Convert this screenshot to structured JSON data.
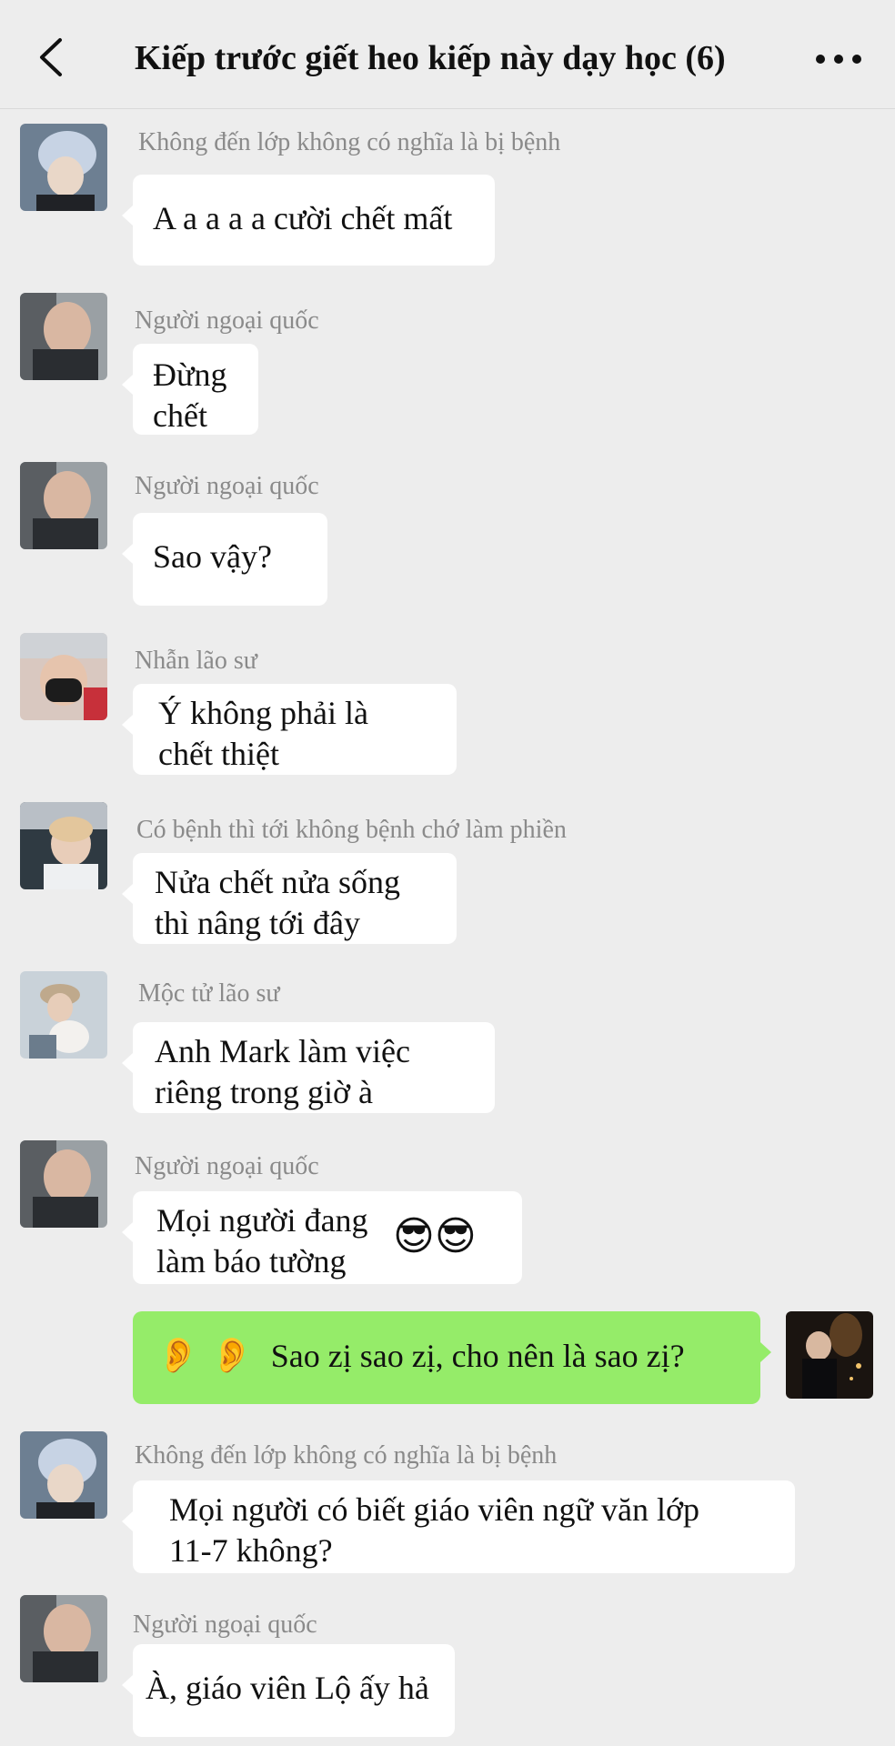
{
  "header": {
    "title": "Kiếp trước giết heo kiếp này dạy học (6)",
    "back_icon": "chevron-left-icon",
    "more_icon": "more-horizontal-icon"
  },
  "colors": {
    "background": "#ededed",
    "incoming_bubble": "#ffffff",
    "outgoing_bubble": "#95ec69",
    "sender_name": "#8a8a8a"
  },
  "messages": [
    {
      "sender": "Không đến lớp không có nghĩa là bị bệnh",
      "avatar": "avatar-silver-hair",
      "lines": [
        "A a a a a cười chết mất"
      ]
    },
    {
      "sender": "Người ngoại quốc",
      "avatar": "avatar-upside-down",
      "lines": [
        "Đừng",
        "chết"
      ]
    },
    {
      "sender": "Người ngoại quốc",
      "avatar": "avatar-upside-down",
      "lines": [
        "Sao vậy?"
      ]
    },
    {
      "sender": "Nhẫn lão sư",
      "avatar": "avatar-masked-beanie",
      "lines": [
        "Ý không phải là",
        "chết thiệt"
      ]
    },
    {
      "sender": "Có bệnh thì tới không bệnh chớ làm phiền",
      "avatar": "avatar-car-seat",
      "lines": [
        "Nửa chết nửa sống",
        "thì nâng tới đây"
      ]
    },
    {
      "sender": "Mộc tử lão sư",
      "avatar": "avatar-holding-dog",
      "lines": [
        "Anh Mark làm việc",
        "riêng trong giờ à"
      ]
    },
    {
      "sender": "Người ngoại quốc",
      "avatar": "avatar-upside-down",
      "lines": [
        "Mọi người đang",
        "làm báo tường"
      ],
      "emoji": "😎😎"
    },
    {
      "sender": "",
      "avatar": "avatar-self-night",
      "outgoing": true,
      "prefix_emoji": "👂 👂",
      "lines": [
        "Sao zị sao zị, cho nên là sao zị?"
      ]
    },
    {
      "sender": "Không đến lớp không có nghĩa là bị bệnh",
      "avatar": "avatar-silver-hair",
      "lines": [
        "Mọi người có biết giáo viên ngữ văn lớp",
        "11-7 không?"
      ]
    },
    {
      "sender": "Người ngoại quốc",
      "avatar": "avatar-upside-down",
      "lines": [
        "À, giáo viên Lộ ấy hả"
      ]
    }
  ]
}
